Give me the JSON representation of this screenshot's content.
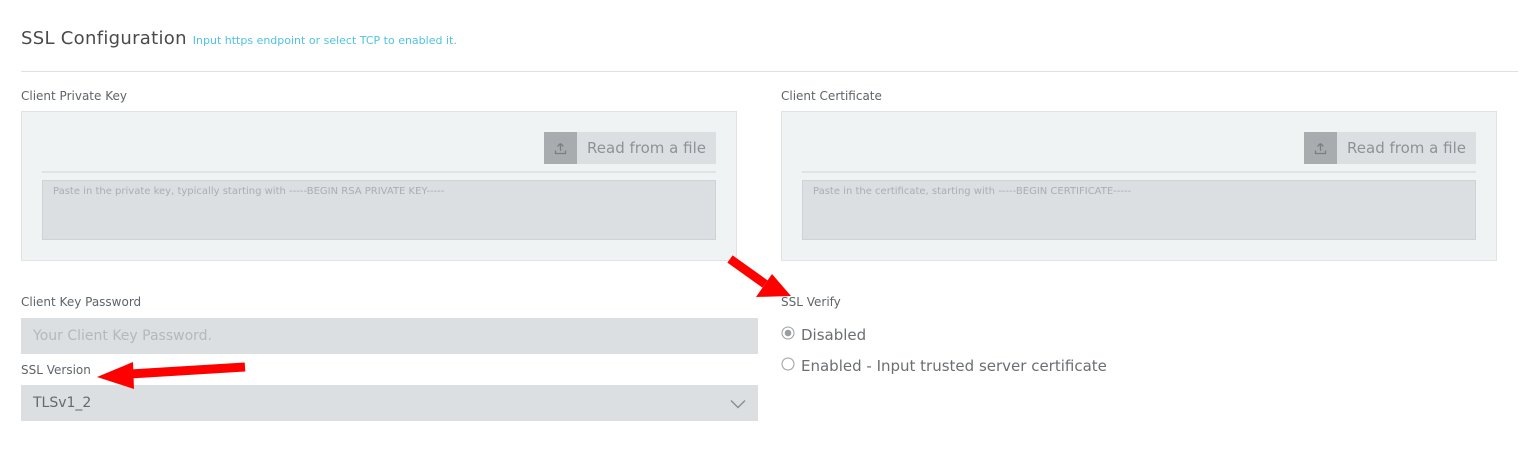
{
  "header": {
    "title": "SSL Configuration",
    "hint": "Input https endpoint or select TCP to enabled it."
  },
  "client_private_key": {
    "label": "Client Private Key",
    "read_file_label": "Read from a file",
    "placeholder": "Paste in the private key, typically starting with -----BEGIN RSA PRIVATE KEY-----"
  },
  "client_certificate": {
    "label": "Client Certificate",
    "read_file_label": "Read from a file",
    "placeholder": "Paste in the certificate, starting with -----BEGIN CERTIFICATE-----"
  },
  "client_key_password": {
    "label": "Client Key Password",
    "placeholder": "Your Client Key Password."
  },
  "ssl_version": {
    "label": "SSL Version",
    "selected": "TLSv1_2"
  },
  "ssl_verify": {
    "label": "SSL Verify",
    "options": [
      {
        "label": "Disabled",
        "checked": true
      },
      {
        "label": "Enabled - Input trusted server certificate",
        "checked": false
      }
    ]
  },
  "colors": {
    "accent_hint": "#4fc3e0",
    "annotation_arrow": "#ff0000"
  }
}
